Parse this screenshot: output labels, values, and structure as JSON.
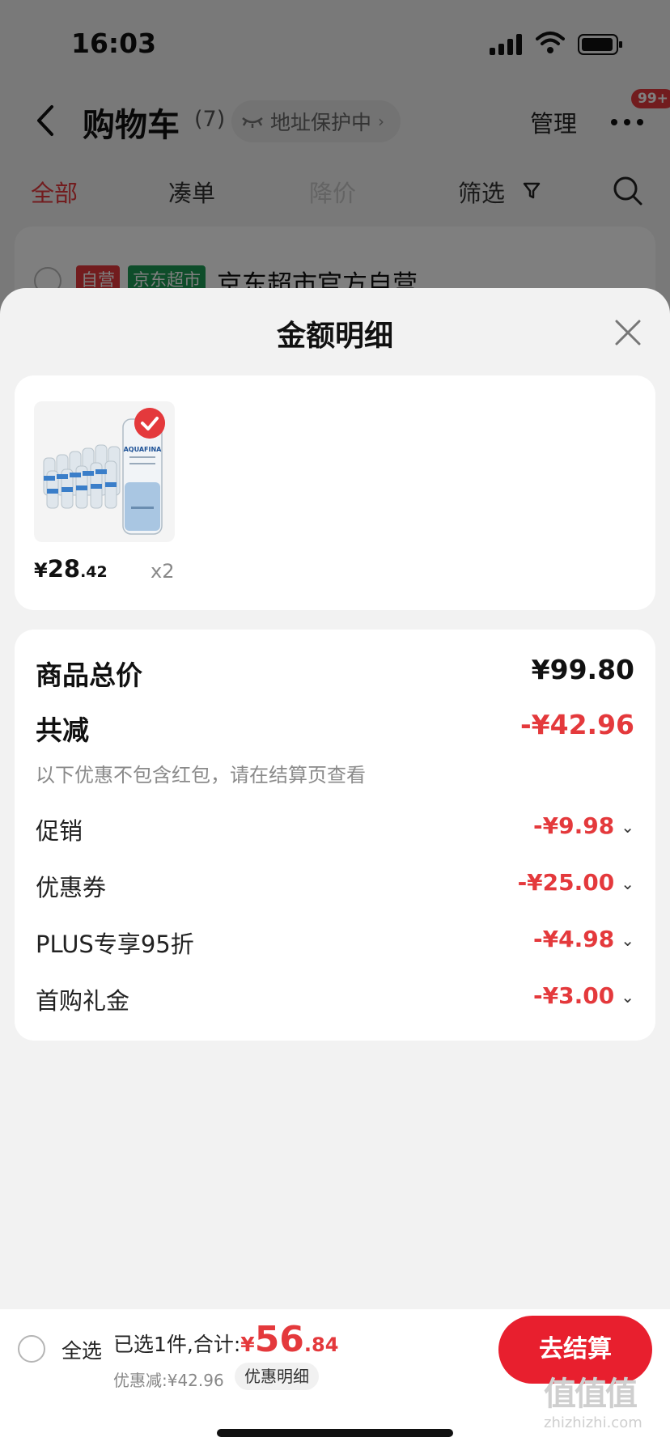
{
  "status_bar": {
    "time": "16:03"
  },
  "nav": {
    "title": "购物车",
    "count": "(7)",
    "address": "地址保护中",
    "manage": "管理",
    "badge": "99+"
  },
  "tabs": [
    {
      "label": "全部"
    },
    {
      "label": "凑单"
    },
    {
      "label": "降价"
    },
    {
      "label": "筛选"
    }
  ],
  "store": {
    "tag_self": "自营",
    "tag_market": "京东超市",
    "name": "京东超市官方自营"
  },
  "sheet": {
    "title": "金额明细",
    "product": {
      "brand_text": "AQUAFINA",
      "price_symbol": "¥",
      "price_int": "28",
      "price_dec": ".42",
      "quantity": "x2"
    },
    "total": {
      "label": "商品总价",
      "value": "¥99.80"
    },
    "reduce": {
      "label": "共减",
      "value": "-¥42.96",
      "note": "以下优惠不包含红包，请在结算页查看"
    },
    "items": [
      {
        "label": "促销",
        "value": "-¥9.98"
      },
      {
        "label": "优惠券",
        "value": "-¥25.00"
      },
      {
        "label": "PLUS专享95折",
        "value": "-¥4.98"
      },
      {
        "label": "首购礼金",
        "value": "-¥3.00"
      }
    ]
  },
  "bottom_bar": {
    "select_all": "全选",
    "selected_text": "已选1件,合计:",
    "total_symbol": "¥",
    "total_int": "56",
    "total_dec": ".84",
    "discount": "优惠减:¥42.96",
    "detail_button": "优惠明细",
    "checkout_button": "去结算"
  },
  "watermark": {
    "top": "值值值",
    "bottom": "zhizhizhi.com"
  },
  "colors": {
    "accent": "#e4393c",
    "checkout": "#e81f2e",
    "green": "#1c9b54"
  }
}
